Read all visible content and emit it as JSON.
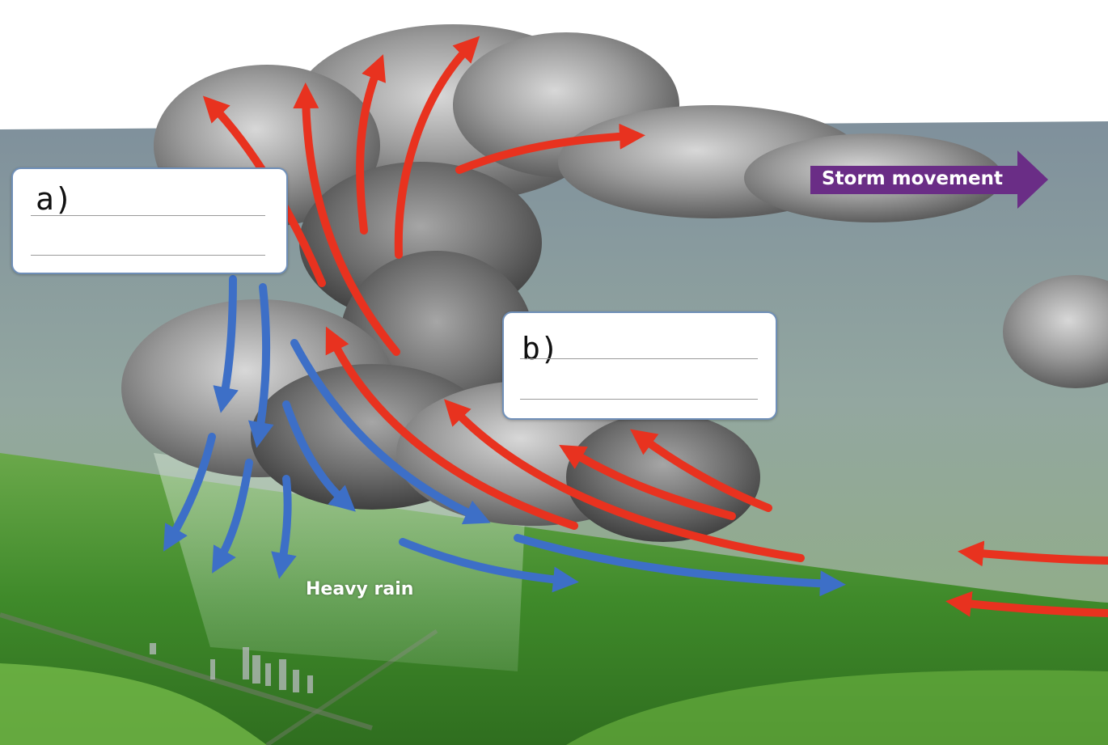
{
  "labels": {
    "box_a": "a)",
    "box_b": "b)",
    "storm_movement": "Storm movement",
    "heavy_rain": "Heavy rain"
  },
  "colors": {
    "updraft_arrow": "#e8321f",
    "downdraft_arrow": "#3d6fc7",
    "storm_arrow": "#6a2d86",
    "sky_top": "#8a9aa5",
    "sky_bottom": "#9fb4a8",
    "ground": "#4f9a2e",
    "cloud": "#8e8e8e"
  },
  "icons": {
    "storm_direction": "right-arrow-icon"
  }
}
